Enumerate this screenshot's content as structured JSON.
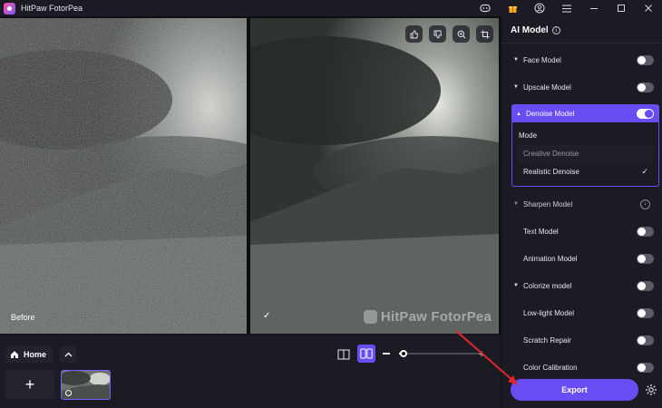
{
  "app": {
    "title": "HitPaw FotorPea",
    "logo_icon": "fotorpea-logo-icon"
  },
  "titlebar": {
    "icons": [
      "discord-icon",
      "gift-icon",
      "account-icon",
      "menu-icon",
      "minimize-icon",
      "maximize-icon",
      "close-icon"
    ]
  },
  "preview": {
    "before_label": "Before",
    "after_icon": "check-icon",
    "watermark": "HitPaw FotorPea",
    "tools": [
      "thumbs-up-icon",
      "thumbs-down-icon",
      "zoom-icon",
      "crop-icon"
    ]
  },
  "bottom": {
    "home_label": "Home",
    "add_label": "+",
    "zoom_level": 0.05
  },
  "panel": {
    "title": "AI Model",
    "models": [
      {
        "label": "Face Model",
        "on": false
      },
      {
        "label": "Upscale Model",
        "on": false
      },
      {
        "label": "Denoise Model",
        "on": true
      },
      {
        "label": "Sharpen Model"
      },
      {
        "label": "Text Model",
        "on": false
      },
      {
        "label": "Animation Model",
        "on": false
      },
      {
        "label": "Colorize model",
        "on": false
      },
      {
        "label": "Low-light Model",
        "on": false
      },
      {
        "label": "Scratch Repair",
        "on": false
      },
      {
        "label": "Color Calibration",
        "on": false
      }
    ],
    "denoise": {
      "mode_label": "Mode",
      "options": [
        "Creative Denoise",
        "Realistic Denoise"
      ],
      "selected": "Realistic Denoise"
    },
    "export_label": "Export"
  },
  "colors": {
    "accent": "#6a4cf5",
    "panel_bg": "#1b1b24",
    "annotation": "#e0262b"
  }
}
